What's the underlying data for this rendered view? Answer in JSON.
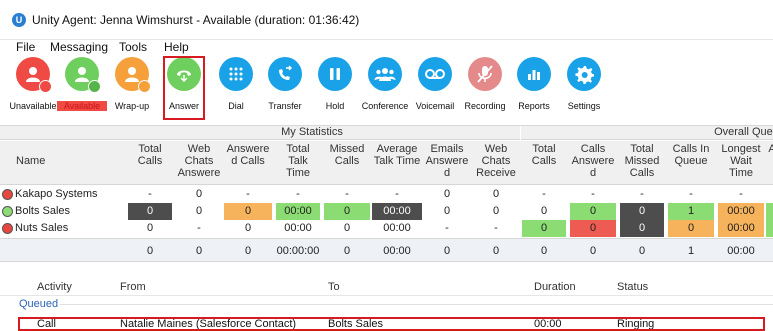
{
  "window": {
    "title": "Unity Agent: Jenna Wimshurst - Available (duration: 01:36:42)"
  },
  "menu": [
    "File",
    "Messaging",
    "Tools",
    "Help"
  ],
  "toolbar": [
    {
      "label": "Unavailable",
      "icon": "unavailable-user-icon",
      "color": "#ef4a43"
    },
    {
      "label": "Available",
      "icon": "available-user-icon",
      "color": "#6fcf5e",
      "label_color": "red"
    },
    {
      "label": "Wrap-up",
      "icon": "wrapup-user-icon",
      "color": "#f5a03a"
    },
    {
      "label": "Answer",
      "icon": "answer-phone-icon",
      "color": "#6fcf5e"
    },
    {
      "label": "Dial",
      "icon": "dial-pad-icon",
      "color": "#1aa2e8"
    },
    {
      "label": "Transfer",
      "icon": "transfer-icon",
      "color": "#1aa2e8"
    },
    {
      "label": "Hold",
      "icon": "hold-icon",
      "color": "#1aa2e8"
    },
    {
      "label": "Conference",
      "icon": "conference-icon",
      "color": "#1aa2e8"
    },
    {
      "label": "Voicemail",
      "icon": "voicemail-icon",
      "color": "#1aa2e8"
    },
    {
      "label": "Recording",
      "icon": "recording-off-icon",
      "color": "#e48a8a"
    },
    {
      "label": "Reports",
      "icon": "reports-icon",
      "color": "#1aa2e8"
    },
    {
      "label": "Settings",
      "icon": "settings-gear-icon",
      "color": "#1aa2e8"
    }
  ],
  "stats": {
    "my_statistics_label": "My Statistics",
    "overall_queues_label": "Overall Queue",
    "columns": [
      "Name",
      "Total Calls",
      "Web Chats Answere",
      "Answere d Calls",
      "Total Talk Time",
      "Missed Calls",
      "Average Talk Time",
      "Emails Answere d",
      "Web Chats Receive",
      "Total Calls",
      "Calls Answere d",
      "Total Missed Calls",
      "Calls In Queue",
      "Longest Wait Time",
      "A"
    ],
    "rows": [
      {
        "name": "Kakapo Systems",
        "status": "red",
        "cells": [
          "-",
          "0",
          "-",
          "-",
          "-",
          "-",
          "0",
          "0",
          "-",
          "-",
          "-",
          "-",
          "-",
          ""
        ]
      },
      {
        "name": "Bolts Sales",
        "status": "green",
        "cells": [
          "0",
          "0",
          "0",
          "00:00",
          "0",
          "00:00",
          "0",
          "0",
          "0",
          "0",
          "0",
          "1",
          "00:00",
          ""
        ]
      },
      {
        "name": "Nuts Sales",
        "status": "red",
        "cells": [
          "0",
          "-",
          "0",
          "00:00",
          "0",
          "00:00",
          "-",
          "-",
          "0",
          "0",
          "0",
          "0",
          "00:00",
          ""
        ]
      }
    ],
    "totals": [
      "0",
      "0",
      "0",
      "00:00:00",
      "0",
      "00:00",
      "0",
      "0",
      "0",
      "0",
      "0",
      "1",
      "00:00"
    ]
  },
  "activity": {
    "columns": [
      "Activity",
      "From",
      "To",
      "Duration",
      "Status"
    ],
    "group_label": "Queued",
    "rows": [
      {
        "activity": "Call",
        "from": "Natalie Maines (Salesforce Contact)",
        "to": "Bolts Sales",
        "duration": "00:00",
        "status": "Ringing"
      }
    ]
  }
}
